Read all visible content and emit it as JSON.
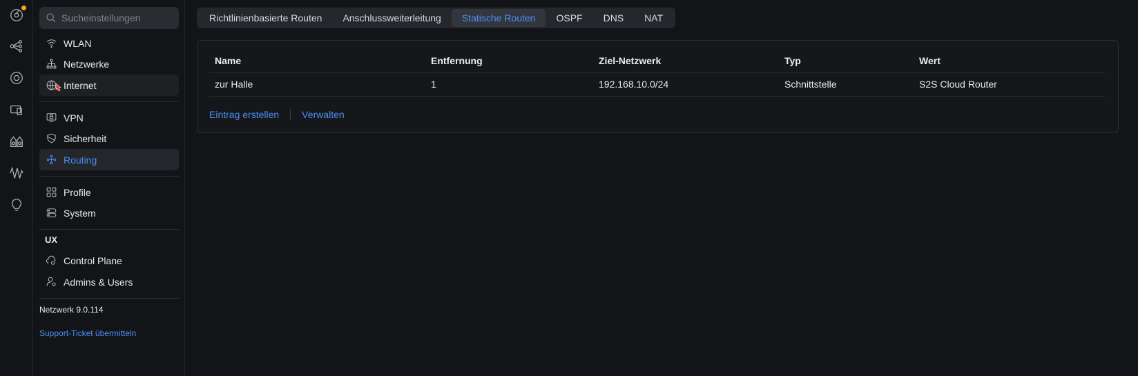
{
  "accent": "#4b8ff7",
  "rail": {
    "icons": [
      "dashboard-icon",
      "topology-icon",
      "devices-icon",
      "clients-icon",
      "insights-icon",
      "statistics-icon",
      "alerts-icon"
    ],
    "notification_color": "#f5a623"
  },
  "sidebar": {
    "search_placeholder": "Sucheinstellungen",
    "items": [
      {
        "label": "WLAN",
        "icon": "wifi-icon"
      },
      {
        "label": "Netzwerke",
        "icon": "network-tree-icon"
      },
      {
        "label": "Internet",
        "icon": "globe-icon"
      },
      {
        "label": "VPN",
        "icon": "vpn-icon"
      },
      {
        "label": "Sicherheit",
        "icon": "shield-icon"
      },
      {
        "label": "Routing",
        "icon": "routing-icon"
      },
      {
        "label": "Profile",
        "icon": "profiles-icon"
      },
      {
        "label": "System",
        "icon": "system-icon"
      }
    ],
    "ux_section": {
      "label": "UX",
      "items": [
        {
          "label": "Control Plane",
          "icon": "cloud-gear-icon"
        },
        {
          "label": "Admins & Users",
          "icon": "user-gear-icon"
        }
      ]
    },
    "version": "Netzwerk 9.0.114",
    "support_link": "Support-Ticket übermitteln"
  },
  "tabs": [
    {
      "label": "Richtlinienbasierte Routen",
      "active": false
    },
    {
      "label": "Anschlussweiterleitung",
      "active": false
    },
    {
      "label": "Statische Routen",
      "active": true
    },
    {
      "label": "OSPF",
      "active": false
    },
    {
      "label": "DNS",
      "active": false
    },
    {
      "label": "NAT",
      "active": false
    }
  ],
  "table": {
    "columns": [
      "Name",
      "Entfernung",
      "Ziel-Netzwerk",
      "Typ",
      "Wert"
    ],
    "rows": [
      [
        "zur Halle",
        "1",
        "192.168.10.0/24",
        "Schnittstelle",
        "S2S Cloud Router"
      ]
    ]
  },
  "actions": {
    "create": "Eintrag erstellen",
    "manage": "Verwalten"
  }
}
